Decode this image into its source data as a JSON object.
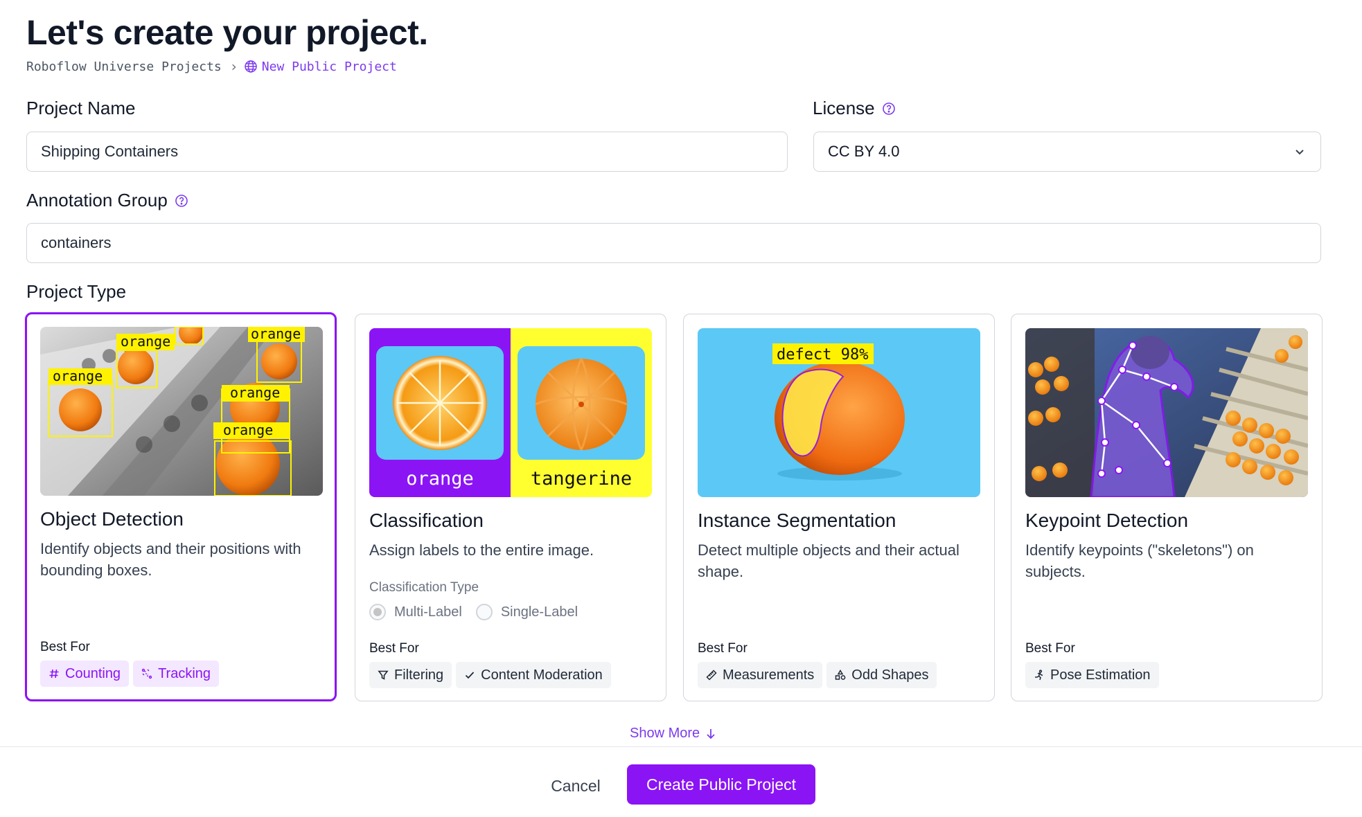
{
  "page": {
    "title": "Let's create your project."
  },
  "breadcrumb": {
    "root": "Roboflow Universe Projects",
    "current": "New Public Project",
    "current_icon": "globe-icon"
  },
  "form": {
    "project_name_label": "Project Name",
    "project_name_value": "Shipping Containers",
    "license_label": "License",
    "license_value": "CC BY 4.0",
    "annotation_group_label": "Annotation Group",
    "annotation_group_value": "containers",
    "project_type_label": "Project Type"
  },
  "project_types": [
    {
      "title": "Object Detection",
      "description": "Identify objects and their positions with bounding boxes.",
      "best_for_label": "Best For",
      "tags": [
        {
          "label": "Counting",
          "icon": "hash-icon"
        },
        {
          "label": "Tracking",
          "icon": "tracking-icon"
        }
      ],
      "image_labels": [
        "orange",
        "orange",
        "orange",
        "orange",
        "orange"
      ],
      "selected": true
    },
    {
      "title": "Classification",
      "description": "Assign labels to the entire image.",
      "classification_type_label": "Classification Type",
      "options": [
        "Multi-Label",
        "Single-Label"
      ],
      "best_for_label": "Best For",
      "tags": [
        {
          "label": "Filtering",
          "icon": "filter-icon"
        },
        {
          "label": "Content Moderation",
          "icon": "check-icon"
        }
      ],
      "image_labels": [
        "orange",
        "tangerine"
      ],
      "selected": false
    },
    {
      "title": "Instance Segmentation",
      "description": "Detect multiple objects and their actual shape.",
      "best_for_label": "Best For",
      "tags": [
        {
          "label": "Measurements",
          "icon": "ruler-icon"
        },
        {
          "label": "Odd Shapes",
          "icon": "shapes-icon"
        }
      ],
      "image_labels": [
        "defect 98%"
      ],
      "selected": false
    },
    {
      "title": "Keypoint Detection",
      "description": "Identify keypoints (\"skeletons\") on subjects.",
      "best_for_label": "Best For",
      "tags": [
        {
          "label": "Pose Estimation",
          "icon": "person-running-icon"
        }
      ],
      "selected": false
    }
  ],
  "actions": {
    "show_more": "Show More",
    "cancel": "Cancel",
    "create": "Create Public Project"
  },
  "colors": {
    "accent": "#8b14f5",
    "accent_light": "#f3e8ff",
    "border": "#d1d5db",
    "label_yellow": "#fff200"
  }
}
